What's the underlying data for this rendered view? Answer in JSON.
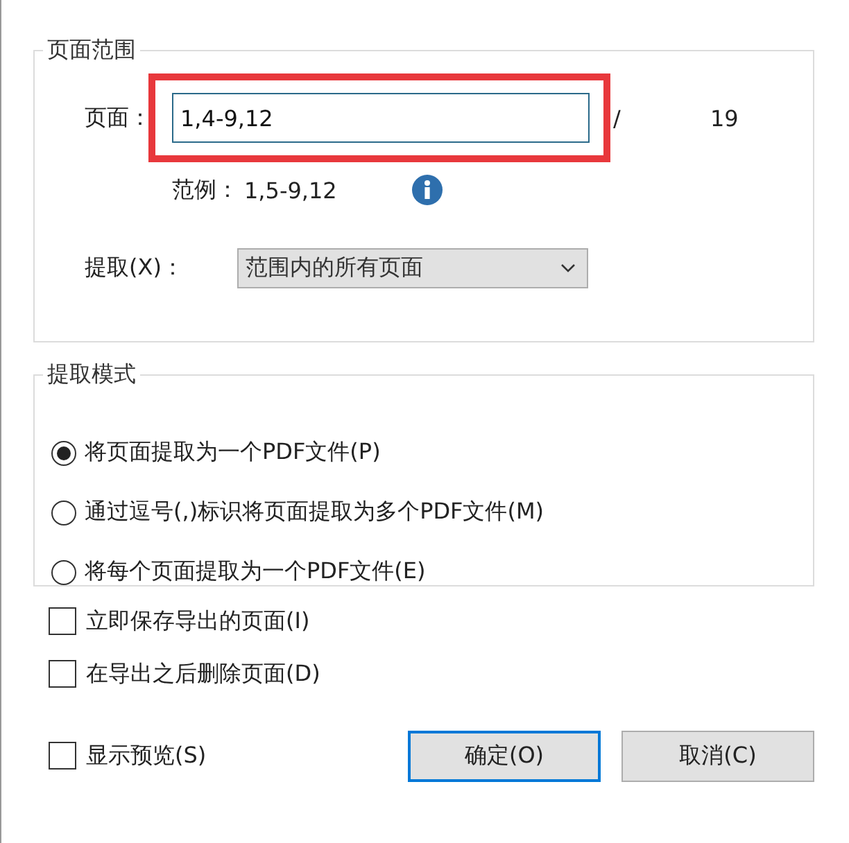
{
  "page_range": {
    "title": "页面范围",
    "pages_label": "页面：",
    "pages_value": "1,4-9,12",
    "highlighted": true,
    "separator": "/",
    "total": "19",
    "example_label": "范例：",
    "example_value": "1,5-9,12",
    "extract_label": "提取(X)：",
    "extract_value": "范围内的所有页面"
  },
  "extract_mode": {
    "title": "提取模式",
    "options": [
      {
        "label": "将页面提取为一个PDF文件(P)",
        "selected": true
      },
      {
        "label": "通过逗号(,)标识将页面提取为多个PDF文件(M)",
        "selected": false
      },
      {
        "label": "将每个页面提取为一个PDF文件(E)",
        "selected": false
      }
    ]
  },
  "options": [
    {
      "label": "立即保存导出的页面(I)",
      "checked": false
    },
    {
      "label": "在导出之后删除页面(D)",
      "checked": false
    }
  ],
  "preview": {
    "label": "显示预览(S)",
    "checked": false
  },
  "buttons": [
    {
      "label": "确定(O)",
      "kind": "default"
    },
    {
      "label": "取消(C)",
      "kind": "normal"
    }
  ]
}
